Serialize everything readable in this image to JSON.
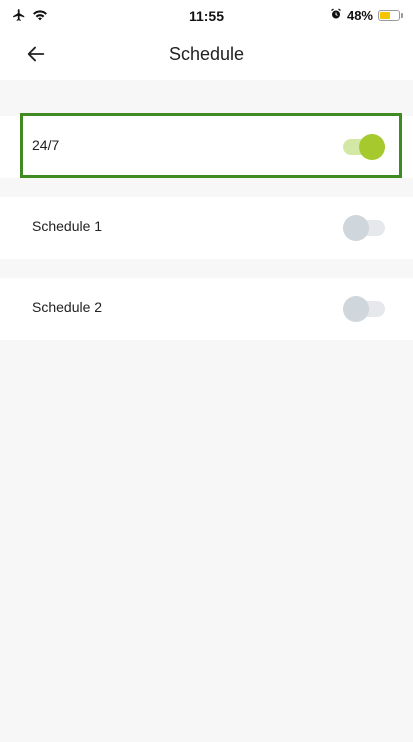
{
  "status_bar": {
    "left_icons": [
      "airplane-icon",
      "wifi-icon"
    ],
    "time": "11:55",
    "alarm_icon": "alarm-icon",
    "battery_percent_text": "48%",
    "battery_level": 0.48,
    "battery_color": "#f5c400"
  },
  "header": {
    "back_icon": "back-arrow-icon",
    "title": "Schedule"
  },
  "rows": [
    {
      "label": "24/7",
      "toggle_on": true,
      "highlighted": true
    },
    {
      "label": "Schedule 1",
      "toggle_on": false,
      "highlighted": false
    },
    {
      "label": "Schedule 2",
      "toggle_on": false,
      "highlighted": false
    }
  ],
  "colors": {
    "background": "#f7f7f7",
    "row_background": "#ffffff",
    "highlight_border": "#3f8b22",
    "toggle_on_knob": "#a6c92e",
    "toggle_on_track": "#d4e8a6",
    "toggle_off_knob": "#cfd6dc",
    "toggle_off_track": "#e6e8eb"
  }
}
